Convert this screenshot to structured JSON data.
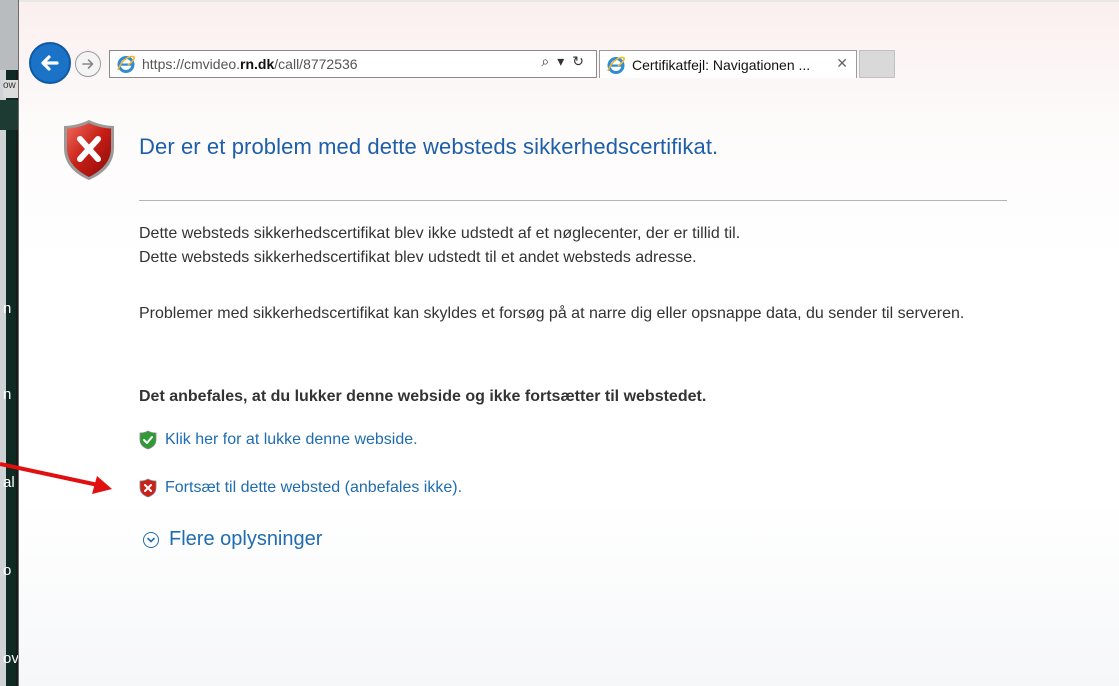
{
  "browser": {
    "url_prefix": "https://cmvideo.",
    "url_domain": "rn.dk",
    "url_suffix": "/call/8772536",
    "search_symbol": "⌕",
    "dropdown_symbol": "▾",
    "refresh_symbol": "↻",
    "tab_title": "Certifikatfejl: Navigationen ...",
    "tab_close": "✕"
  },
  "background": {
    "ow": "ow",
    "n1": "n",
    "n2": "n",
    "al": "al",
    "o1": "o",
    "ov": "ov"
  },
  "page": {
    "title": "Der er et problem med dette websteds sikkerhedscertifikat.",
    "para1_line1": "Dette websteds sikkerhedscertifikat blev ikke udstedt af et nøglecenter, der er tillid til.",
    "para1_line2": "Dette websteds sikkerhedscertifikat blev udstedt til et andet websteds adresse.",
    "para2": "Problemer med sikkerhedscertifikat kan skyldes et forsøg på at narre dig eller opsnappe data, du sender til serveren.",
    "recommendation": "Det anbefales, at du lukker denne webside og ikke fortsætter til webstedet.",
    "close_link": "Klik her for at lukke denne webside.",
    "continue_link": "Fortsæt til dette websted (anbefales ikke).",
    "more_info": "Flere oplysninger"
  },
  "colors": {
    "title_blue": "#1d5fa8",
    "link_blue": "#1f6cb0",
    "annotation_red": "#e01010"
  }
}
